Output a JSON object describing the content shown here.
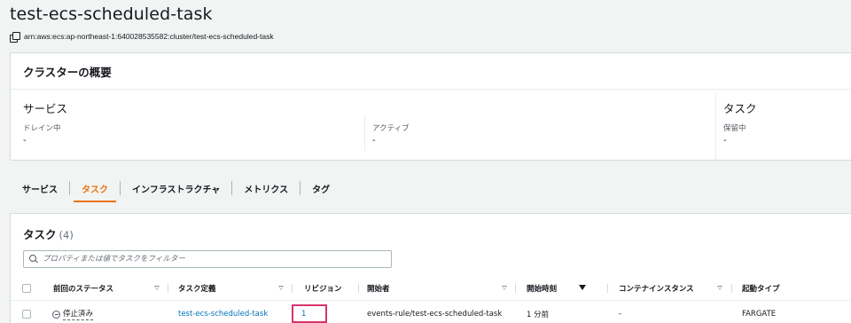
{
  "header": {
    "title": "test-ecs-scheduled-task",
    "arn": "arn:aws:ecs:ap-northeast-1:640028535582:cluster/test-ecs-scheduled-task"
  },
  "overview": {
    "title": "クラスターの概要",
    "services_title": "サービス",
    "tasks_title": "タスク",
    "draining_label": "ドレイン中",
    "draining_value": "-",
    "active_label": "アクティブ",
    "active_value": "-",
    "pending_label": "保留中",
    "pending_value": "-"
  },
  "tabs": [
    {
      "label": "サービス",
      "active": false
    },
    {
      "label": "タスク",
      "active": true
    },
    {
      "label": "インフラストラクチャ",
      "active": false
    },
    {
      "label": "メトリクス",
      "active": false
    },
    {
      "label": "タグ",
      "active": false
    }
  ],
  "tasks": {
    "title": "タスク",
    "count": "(4)",
    "filter_placeholder": "プロパティまたは値でタスクをフィルター",
    "columns": {
      "last_status": "前回のステータス",
      "task_definition": "タスク定義",
      "revision": "リビジョン",
      "started_by": "開始者",
      "started_at": "開始時刻",
      "container_instance": "コンテナインスタンス",
      "launch_type": "起動タイプ"
    },
    "rows": [
      {
        "last_status": "停止済み",
        "task_definition": "test-ecs-scheduled-task",
        "revision": "1",
        "started_by": "events-rule/test-ecs-scheduled-task",
        "started_at": "1 分前",
        "container_instance": "-",
        "launch_type": "FARGATE"
      }
    ]
  },
  "colors": {
    "accent": "#ec7211",
    "link": "#0073bb",
    "highlight": "#d6346e"
  }
}
